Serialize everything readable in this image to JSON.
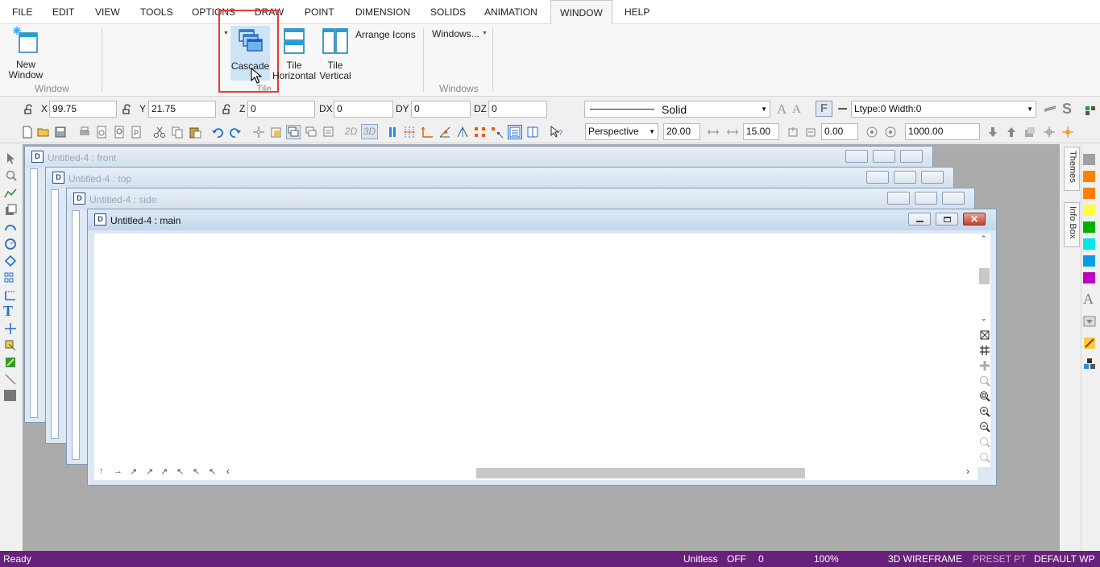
{
  "menu": [
    "FILE",
    "EDIT",
    "VIEW",
    "TOOLS",
    "OPTIONS",
    "DRAW",
    "POINT",
    "DIMENSION",
    "SOLIDS",
    "ANIMATION",
    "WINDOW",
    "HELP"
  ],
  "ribbon": {
    "new_window": {
      "line1": "New",
      "line2": "Window"
    },
    "group_window": "Window",
    "cascade": "Cascade",
    "tile_horizontal": {
      "line1": "Tile",
      "line2": "Horizontal"
    },
    "tile_vertical": {
      "line1": "Tile",
      "line2": "Vertical"
    },
    "arrange_icons": "Arrange Icons",
    "group_tile": "Tile",
    "windows_dropdown": "Windows...",
    "group_windows": "Windows"
  },
  "coords": {
    "x_label": "X",
    "x_value": "99.75",
    "y_label": "Y",
    "y_value": "21.75",
    "z_label": "Z",
    "z_value": "0",
    "dx_label": "DX",
    "dx_value": "0",
    "dy_label": "DY",
    "dy_value": "0",
    "dz_label": "DZ",
    "dz_value": "0"
  },
  "line_style": {
    "value": "Solid",
    "ltype": "Ltype:0  Width:0"
  },
  "view": {
    "projection": "Perspective",
    "field1": "20.00",
    "field2": "15.00",
    "field3": "0.00",
    "field4": "1000.00",
    "mode_2d": "2D",
    "mode_3d": "3D"
  },
  "windows": [
    {
      "title": "Untitled-4 : front"
    },
    {
      "title": "Untitled-4 : top"
    },
    {
      "title": "Untitled-4 : side"
    },
    {
      "title": "Untitled-4 : main"
    }
  ],
  "side_tabs": {
    "themes": "Themes",
    "info": "Info Box"
  },
  "swatches": [
    "#a0a0a0",
    "#ff7f00",
    "#ff7f00",
    "#ffff40",
    "#00b000",
    "#00e8e8",
    "#00a0e8",
    "#c000c0"
  ],
  "status": {
    "ready": "Ready",
    "units": "Unitless",
    "snap": "OFF",
    "count": "0",
    "zoom": "100%",
    "render": "3D WIREFRAME",
    "preset": "PRESET PT",
    "wp": "DEFAULT WP"
  },
  "colors": {
    "status_bar": "#68217a",
    "highlight_box": "#e53935",
    "workspace": "#ababab"
  }
}
